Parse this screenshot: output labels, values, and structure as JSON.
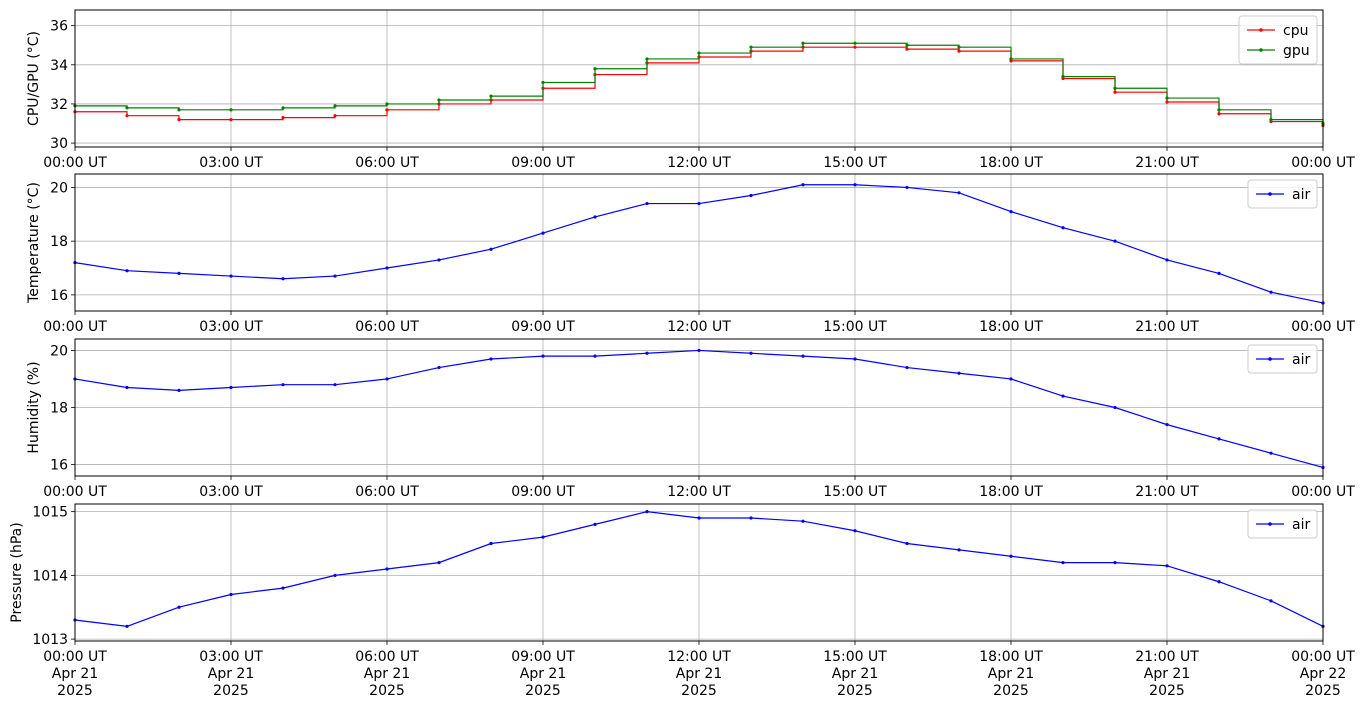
{
  "x_ticks": [
    "00:00 UT",
    "03:00 UT",
    "06:00 UT",
    "09:00 UT",
    "12:00 UT",
    "15:00 UT",
    "18:00 UT",
    "21:00 UT",
    "00:00 UT"
  ],
  "x_dates": [
    "Apr 21\n2025",
    "Apr 21\n2025",
    "Apr 21\n2025",
    "Apr 21\n2025",
    "Apr 21\n2025",
    "Apr 21\n2025",
    "Apr 21\n2025",
    "Apr 21\n2025",
    "Apr 22\n2025"
  ],
  "colors": {
    "cpu": "#ff0000",
    "gpu": "#008000",
    "air": "#0000ff",
    "grid": "#b0b0b0"
  },
  "chart_data": [
    {
      "type": "line",
      "ylabel": "CPU/GPU (°C)",
      "ylim": [
        29.8,
        36.8
      ],
      "yticks": [
        30,
        32,
        34,
        36
      ],
      "xlim": [
        "2025-04-21 00:00",
        "2025-04-22 00:00"
      ],
      "grid": true,
      "legend": "top-right",
      "series": [
        {
          "name": "cpu",
          "color": "#ff0000",
          "x": [
            "2025-04-21 00:00",
            "2025-04-21 01:00",
            "2025-04-21 02:00",
            "2025-04-21 03:00",
            "2025-04-21 04:00",
            "2025-04-21 05:00",
            "2025-04-21 06:00",
            "2025-04-21 07:00",
            "2025-04-21 08:00",
            "2025-04-21 09:00",
            "2025-04-21 10:00",
            "2025-04-21 11:00",
            "2025-04-21 12:00",
            "2025-04-21 13:00",
            "2025-04-21 14:00",
            "2025-04-21 15:00",
            "2025-04-21 16:00",
            "2025-04-21 17:00",
            "2025-04-21 18:00",
            "2025-04-21 19:00",
            "2025-04-21 20:00",
            "2025-04-21 21:00",
            "2025-04-21 22:00",
            "2025-04-21 23:00",
            "2025-04-22 00:00"
          ],
          "values": [
            31.6,
            31.4,
            31.2,
            31.2,
            31.3,
            31.4,
            31.7,
            32.0,
            32.2,
            32.8,
            33.5,
            34.1,
            34.4,
            34.7,
            34.9,
            34.9,
            34.8,
            34.7,
            34.2,
            33.3,
            32.6,
            32.1,
            31.5,
            31.1,
            30.9
          ]
        },
        {
          "name": "gpu",
          "color": "#008000",
          "x": [
            "2025-04-21 00:00",
            "2025-04-21 01:00",
            "2025-04-21 02:00",
            "2025-04-21 03:00",
            "2025-04-21 04:00",
            "2025-04-21 05:00",
            "2025-04-21 06:00",
            "2025-04-21 07:00",
            "2025-04-21 08:00",
            "2025-04-21 09:00",
            "2025-04-21 10:00",
            "2025-04-21 11:00",
            "2025-04-21 12:00",
            "2025-04-21 13:00",
            "2025-04-21 14:00",
            "2025-04-21 15:00",
            "2025-04-21 16:00",
            "2025-04-21 17:00",
            "2025-04-21 18:00",
            "2025-04-21 19:00",
            "2025-04-21 20:00",
            "2025-04-21 21:00",
            "2025-04-21 22:00",
            "2025-04-21 23:00",
            "2025-04-22 00:00"
          ],
          "values": [
            31.9,
            31.8,
            31.7,
            31.7,
            31.8,
            31.9,
            32.0,
            32.2,
            32.4,
            33.1,
            33.8,
            34.3,
            34.6,
            34.9,
            35.1,
            35.1,
            35.0,
            34.9,
            34.3,
            33.4,
            32.8,
            32.3,
            31.7,
            31.2,
            31.0
          ]
        }
      ]
    },
    {
      "type": "line",
      "ylabel": "Temperature (°C)",
      "ylim": [
        15.4,
        20.5
      ],
      "yticks": [
        16,
        18,
        20
      ],
      "xlim": [
        "2025-04-21 00:00",
        "2025-04-22 00:00"
      ],
      "grid": true,
      "legend": "top-right",
      "series": [
        {
          "name": "air",
          "color": "#0000ff",
          "x": [
            "2025-04-21 00:00",
            "2025-04-21 01:00",
            "2025-04-21 02:00",
            "2025-04-21 03:00",
            "2025-04-21 04:00",
            "2025-04-21 05:00",
            "2025-04-21 06:00",
            "2025-04-21 07:00",
            "2025-04-21 08:00",
            "2025-04-21 09:00",
            "2025-04-21 10:00",
            "2025-04-21 11:00",
            "2025-04-21 12:00",
            "2025-04-21 13:00",
            "2025-04-21 14:00",
            "2025-04-21 15:00",
            "2025-04-21 16:00",
            "2025-04-21 17:00",
            "2025-04-21 18:00",
            "2025-04-21 19:00",
            "2025-04-21 20:00",
            "2025-04-21 21:00",
            "2025-04-21 22:00",
            "2025-04-21 23:00",
            "2025-04-22 00:00"
          ],
          "values": [
            17.2,
            16.9,
            16.8,
            16.7,
            16.6,
            16.7,
            17.0,
            17.3,
            17.7,
            18.3,
            18.9,
            19.4,
            19.4,
            19.7,
            20.1,
            20.1,
            20.0,
            19.8,
            19.1,
            18.5,
            18.0,
            17.3,
            16.8,
            16.1,
            15.7
          ]
        }
      ]
    },
    {
      "type": "line",
      "ylabel": "Humidity (%)",
      "ylim": [
        15.6,
        20.4
      ],
      "yticks": [
        16,
        18,
        20
      ],
      "xlim": [
        "2025-04-21 00:00",
        "2025-04-22 00:00"
      ],
      "grid": true,
      "legend": "top-right",
      "series": [
        {
          "name": "air",
          "color": "#0000ff",
          "x": [
            "2025-04-21 00:00",
            "2025-04-21 01:00",
            "2025-04-21 02:00",
            "2025-04-21 03:00",
            "2025-04-21 04:00",
            "2025-04-21 05:00",
            "2025-04-21 06:00",
            "2025-04-21 07:00",
            "2025-04-21 08:00",
            "2025-04-21 09:00",
            "2025-04-21 10:00",
            "2025-04-21 11:00",
            "2025-04-21 12:00",
            "2025-04-21 13:00",
            "2025-04-21 14:00",
            "2025-04-21 15:00",
            "2025-04-21 16:00",
            "2025-04-21 17:00",
            "2025-04-21 18:00",
            "2025-04-21 19:00",
            "2025-04-21 20:00",
            "2025-04-21 21:00",
            "2025-04-21 22:00",
            "2025-04-21 23:00",
            "2025-04-22 00:00"
          ],
          "values": [
            19.0,
            18.7,
            18.6,
            18.7,
            18.8,
            18.8,
            19.0,
            19.4,
            19.7,
            19.8,
            19.8,
            19.9,
            20.0,
            19.9,
            19.8,
            19.7,
            19.4,
            19.2,
            19.0,
            18.4,
            18.0,
            17.4,
            16.9,
            16.4,
            15.9
          ]
        }
      ]
    },
    {
      "type": "line",
      "ylabel": "Pressure (hPa)",
      "ylim": [
        1012.97,
        1015.12
      ],
      "yticks": [
        1013,
        1014,
        1015
      ],
      "xlim": [
        "2025-04-21 00:00",
        "2025-04-22 00:00"
      ],
      "grid": true,
      "legend": "top-right",
      "series": [
        {
          "name": "air",
          "color": "#0000ff",
          "x": [
            "2025-04-21 00:00",
            "2025-04-21 01:00",
            "2025-04-21 02:00",
            "2025-04-21 03:00",
            "2025-04-21 04:00",
            "2025-04-21 05:00",
            "2025-04-21 06:00",
            "2025-04-21 07:00",
            "2025-04-21 08:00",
            "2025-04-21 09:00",
            "2025-04-21 10:00",
            "2025-04-21 11:00",
            "2025-04-21 12:00",
            "2025-04-21 13:00",
            "2025-04-21 14:00",
            "2025-04-21 15:00",
            "2025-04-21 16:00",
            "2025-04-21 17:00",
            "2025-04-21 18:00",
            "2025-04-21 19:00",
            "2025-04-21 20:00",
            "2025-04-21 21:00",
            "2025-04-21 22:00",
            "2025-04-21 23:00",
            "2025-04-22 00:00"
          ],
          "values": [
            1013.3,
            1013.2,
            1013.5,
            1013.7,
            1013.8,
            1014.0,
            1014.1,
            1014.2,
            1014.5,
            1014.6,
            1014.8,
            1015.0,
            1014.9,
            1014.9,
            1014.85,
            1014.7,
            1014.5,
            1014.4,
            1014.3,
            1014.2,
            1014.2,
            1014.15,
            1013.9,
            1013.6,
            1013.2
          ]
        }
      ]
    }
  ]
}
